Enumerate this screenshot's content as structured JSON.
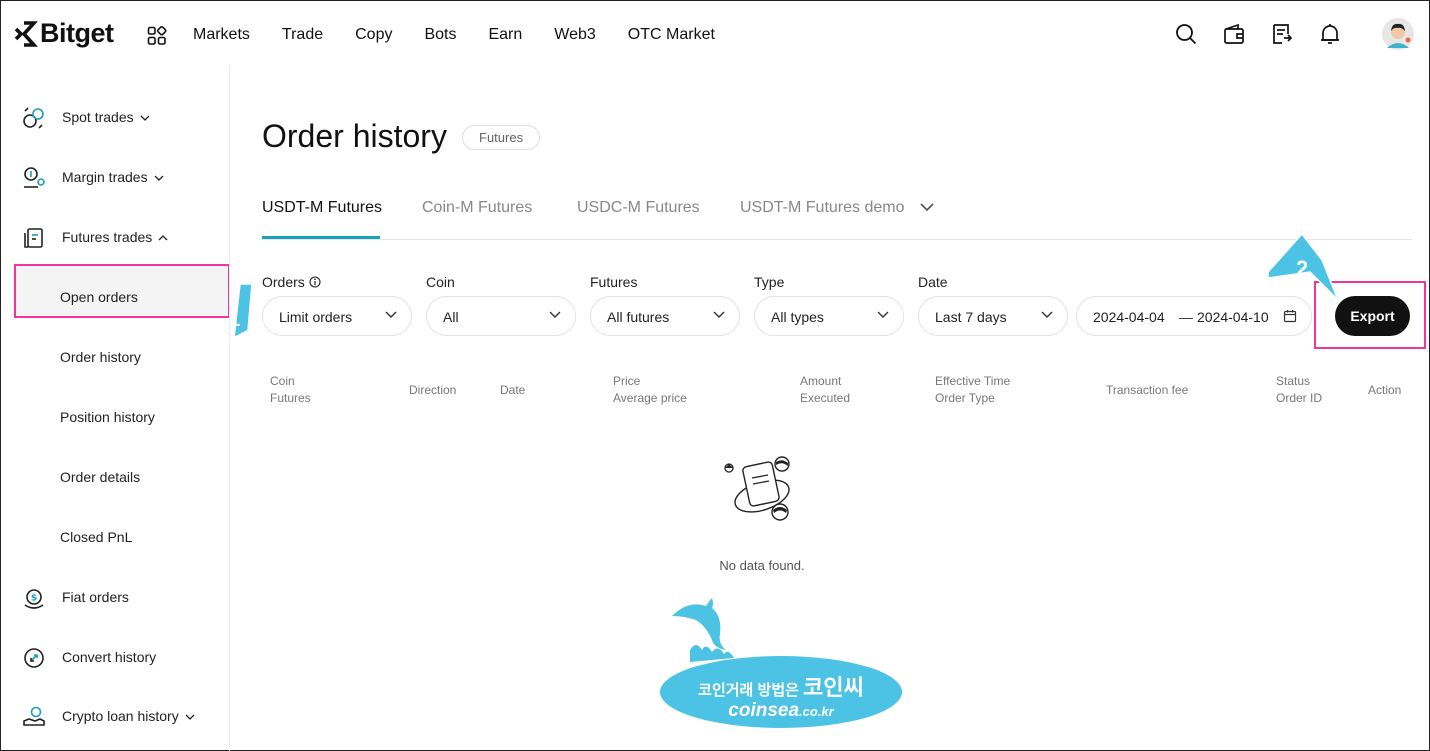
{
  "brand": {
    "name": "Bitget"
  },
  "nav": {
    "links": [
      "Markets",
      "Trade",
      "Copy",
      "Bots",
      "Earn",
      "Web3",
      "OTC Market"
    ]
  },
  "sidebar": {
    "items": [
      {
        "label": "Spot trades",
        "icon": "spot-icon",
        "chevron": "down"
      },
      {
        "label": "Margin trades",
        "icon": "margin-icon",
        "chevron": "down"
      },
      {
        "label": "Futures trades",
        "icon": "futures-icon",
        "chevron": "up"
      },
      {
        "label": "Open orders"
      },
      {
        "label": "Order history",
        "active": true
      },
      {
        "label": "Position history"
      },
      {
        "label": "Order details"
      },
      {
        "label": "Closed PnL"
      },
      {
        "label": "Fiat orders",
        "icon": "fiat-icon"
      },
      {
        "label": "Convert history",
        "icon": "convert-icon"
      },
      {
        "label": "Crypto loan history",
        "icon": "loan-icon",
        "chevron": "down"
      }
    ]
  },
  "page": {
    "title": "Order history",
    "badge": "Futures"
  },
  "tabs": [
    "USDT-M Futures",
    "Coin-M Futures",
    "USDC-M Futures",
    "USDT-M Futures demo"
  ],
  "filters": {
    "orders": {
      "label": "Orders",
      "value": "Limit orders"
    },
    "coin": {
      "label": "Coin",
      "value": "All"
    },
    "futures": {
      "label": "Futures",
      "value": "All futures"
    },
    "type": {
      "label": "Type",
      "value": "All types"
    },
    "date": {
      "label": "Date",
      "value": "Last 7 days"
    },
    "range": {
      "start": "2024-04-04",
      "sep": "—",
      "end": "2024-04-10"
    }
  },
  "export_label": "Export",
  "table": {
    "headers": {
      "coin": "Coin",
      "futures": "Futures",
      "direction": "Direction",
      "date": "Date",
      "price": "Price",
      "avg_price": "Average price",
      "amount": "Amount",
      "executed": "Executed",
      "eff_time": "Effective Time",
      "order_type": "Order Type",
      "fee": "Transaction fee",
      "status": "Status",
      "order_id": "Order ID",
      "action": "Action"
    },
    "empty": "No data found."
  },
  "annotations": {
    "step1": "1",
    "step2": "2"
  },
  "watermark": {
    "line1": "코인거래 방법은",
    "line1_big": "코인씨",
    "line2": "coinsea",
    "line2_small": ".co.kr"
  },
  "colors": {
    "accent": "#1aa0b8",
    "highlight": "#f0369a",
    "arrow": "#4cc3e4"
  }
}
